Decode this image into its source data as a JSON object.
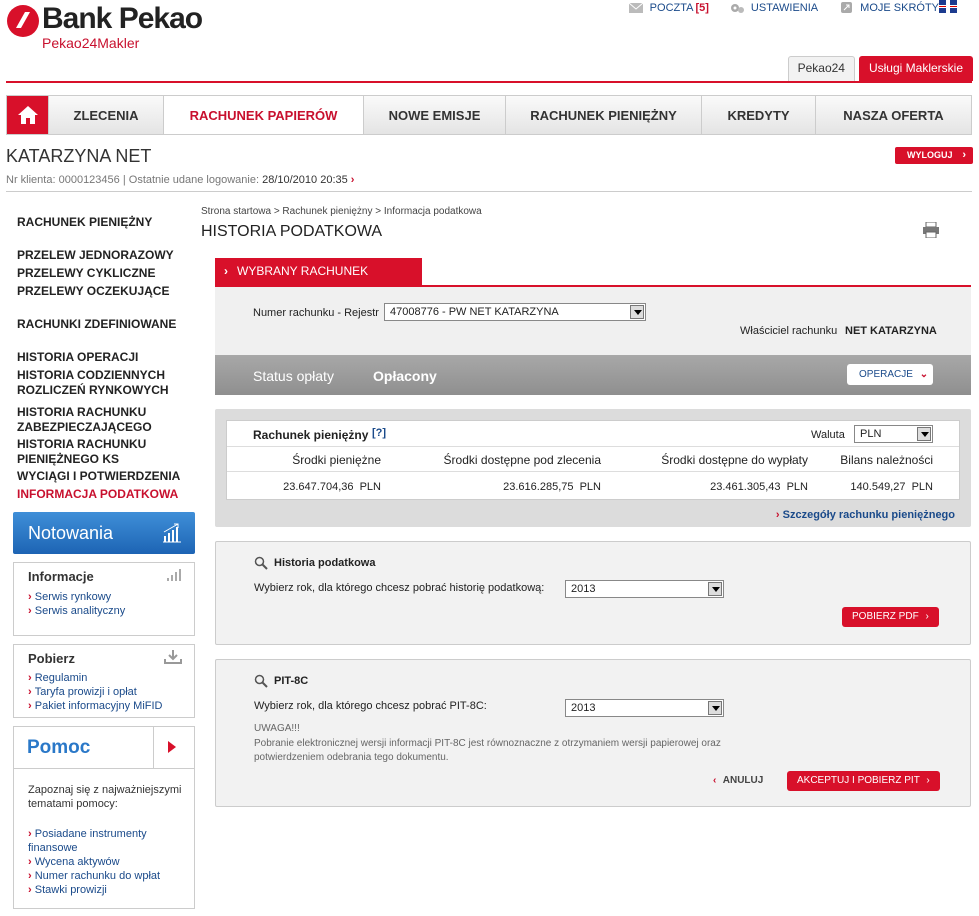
{
  "brand": {
    "name": "Bank Pekao",
    "sub": "Pekao24Makler"
  },
  "topnav": {
    "mail_label": "POCZTA",
    "mail_count": "[5]",
    "settings": "USTAWIENIA",
    "shortcuts": "MOJE SKRÓTY"
  },
  "context_tabs": [
    "Pekao24",
    "Usługi Maklerskie"
  ],
  "mainnav": [
    "ZLECENIA",
    "RACHUNEK PAPIERÓW",
    "NOWE EMISJE",
    "RACHUNEK PIENIĘŻNY",
    "KREDYTY",
    "NASZA OFERTA"
  ],
  "user": {
    "name": "KATARZYNA NET",
    "logout": "WYLOGUJ",
    "client_label": "Nr klienta:",
    "client_no": "0000123456",
    "last_login_label": "Ostatnie udane logowanie:",
    "last_login": "28/10/2010 20:35"
  },
  "sidebar": {
    "items": [
      {
        "label": "RACHUNEK PIENIĘŻNY"
      },
      {
        "label": "PRZELEW JEDNORAZOWY"
      },
      {
        "label": "PRZELEWY CYKLICZNE"
      },
      {
        "label": "PRZELEWY OCZEKUJĄCE"
      },
      {
        "label": "RACHUNKI ZDEFINIOWANE"
      },
      {
        "label": "HISTORIA OPERACJI"
      },
      {
        "label": "HISTORIA CODZIENNYCH ROZLICZEŃ RYNKOWYCH"
      },
      {
        "label": "HISTORIA RACHUNKU ZABEZPIECZAJĄCEGO"
      },
      {
        "label": "HISTORIA RACHUNKU PIENIĘŻNEGO KS"
      },
      {
        "label": "WYCIĄGI I POTWIERDZENIA"
      },
      {
        "label": "INFORMACJA PODATKOWA"
      }
    ]
  },
  "notowania": "Notowania",
  "informacje": {
    "title": "Informacje",
    "links": [
      "Serwis rynkowy",
      "Serwis analityczny"
    ]
  },
  "pobierz": {
    "title": "Pobierz",
    "links": [
      "Regulamin",
      "Taryfa prowizji i opłat",
      "Pakiet informacyjny MiFID"
    ]
  },
  "pomoc": {
    "title": "Pomoc",
    "intro": "Zapoznaj się z najważniejszymi tematami pomocy:",
    "links": [
      "Posiadane instrumenty finansowe",
      "Wycena aktywów",
      "Numer rachunku do wpłat",
      "Stawki prowizji"
    ]
  },
  "breadcrumb": "Strona startowa > Rachunek pieniężny > Informacja podatkowa",
  "page_title": "HISTORIA PODATKOWA",
  "selected_account": {
    "tab": "WYBRANY RACHUNEK",
    "label": "Numer rachunku - Rejestr",
    "value": "47008776 - PW NET KATARZYNA",
    "owner_label": "Właściciel rachunku",
    "owner": "NET KATARZYNA"
  },
  "status": {
    "label": "Status opłaty",
    "value": "Opłacony",
    "ops": "OPERACJE"
  },
  "cash": {
    "title": "Rachunek pieniężny",
    "help": "[?]",
    "currency_label": "Waluta",
    "currency": "PLN",
    "headers": [
      "Środki pieniężne",
      "Środki dostępne pod zlecenia",
      "Środki dostępne do wypłaty",
      "Bilans należności"
    ],
    "values": [
      "23.647.704,36  PLN",
      "23.616.285,75  PLN",
      "23.461.305,43  PLN",
      "140.549,27  PLN"
    ],
    "details_link": "Szczegóły rachunku pieniężnego"
  },
  "tax_history": {
    "title": "Historia podatkowa",
    "prompt": "Wybierz rok, dla którego chcesz pobrać historię podatkową:",
    "year": "2013",
    "button": "POBIERZ PDF"
  },
  "pit": {
    "title": "PIT-8C",
    "prompt": "Wybierz rok, dla którego chcesz pobrać PIT-8C:",
    "year": "2013",
    "warn_title": "UWAGA!!!",
    "warn_line1": "Pobranie elektronicznej wersji informacji PIT-8C jest równoznaczne z otrzymaniem wersji papierowej oraz",
    "warn_line2": "potwierdzeniem odebrania tego dokumentu.",
    "cancel": "ANULUJ",
    "accept": "AKCEPTUJ I POBIERZ PIT"
  },
  "colors": {
    "accent": "#d8102a",
    "link": "#1a4a8a",
    "blue": "#2a78c8"
  }
}
